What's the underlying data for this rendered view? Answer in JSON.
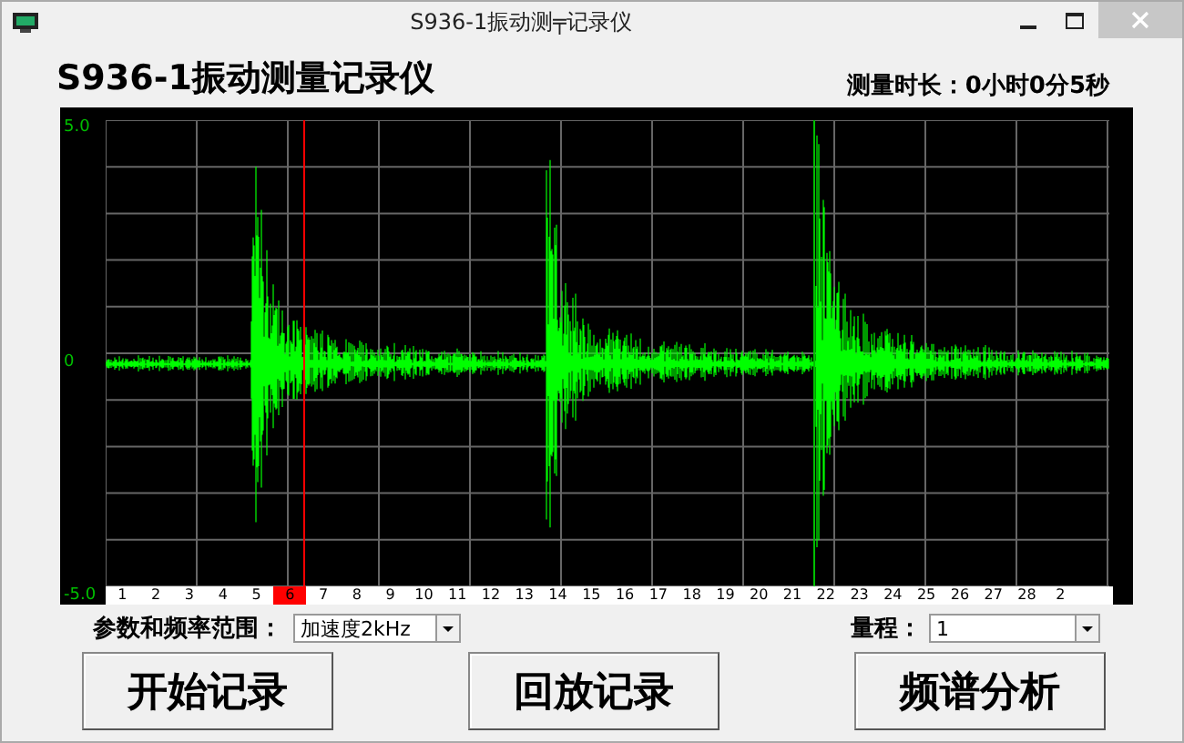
{
  "window": {
    "title": "S936-1振动测╤记录仪"
  },
  "header": {
    "title": "S936-1振动测量记录仪",
    "duration": "测量时长：0小时0分5秒"
  },
  "plot": {
    "y_labels": [
      "5.0",
      "0",
      "-5.0"
    ],
    "x_marks": [
      {
        "label": "1",
        "selected": false
      },
      {
        "label": "2",
        "selected": false
      },
      {
        "label": "3",
        "selected": false
      },
      {
        "label": "4",
        "selected": false
      },
      {
        "label": "5",
        "selected": false
      },
      {
        "label": "6",
        "selected": true
      },
      {
        "label": "7",
        "selected": false
      },
      {
        "label": "8",
        "selected": false
      },
      {
        "label": "9",
        "selected": false
      },
      {
        "label": "10",
        "selected": false
      },
      {
        "label": "11",
        "selected": false
      },
      {
        "label": "12",
        "selected": false
      },
      {
        "label": "13",
        "selected": false
      },
      {
        "label": "14",
        "selected": false
      },
      {
        "label": "15",
        "selected": false
      },
      {
        "label": "16",
        "selected": false
      },
      {
        "label": "17",
        "selected": false
      },
      {
        "label": "18",
        "selected": false
      },
      {
        "label": "19",
        "selected": false
      },
      {
        "label": "20",
        "selected": false
      },
      {
        "label": "21",
        "selected": false
      },
      {
        "label": "22",
        "selected": false
      },
      {
        "label": "23",
        "selected": false
      },
      {
        "label": "24",
        "selected": false
      },
      {
        "label": "25",
        "selected": false
      },
      {
        "label": "26",
        "selected": false
      },
      {
        "label": "27",
        "selected": false
      },
      {
        "label": "28",
        "selected": false
      },
      {
        "label": "2",
        "selected": false
      }
    ]
  },
  "controls": {
    "param_label": "参数和频率范围：",
    "param_value": "加速度2kHz",
    "range_label": "量程：",
    "range_value": "1"
  },
  "buttons": [
    "开始记录",
    "回放记录",
    "频谱分析"
  ]
}
